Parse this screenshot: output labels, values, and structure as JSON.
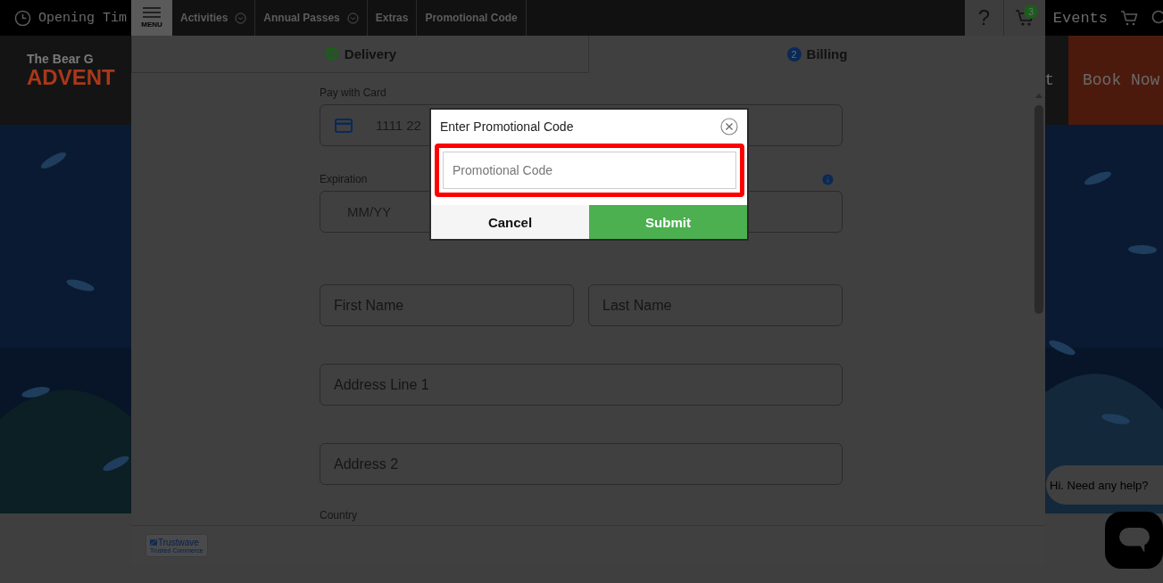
{
  "page_header": {
    "opening_times": "Opening Tim",
    "logo_line_1": "The Bear G",
    "logo_line_2": "ADVENT",
    "events": "Events",
    "nav_fragment": "t",
    "book_now": "Book Now"
  },
  "checkout": {
    "menu_label": "MENU",
    "nav": [
      {
        "label": "Activities",
        "dropdown": true
      },
      {
        "label": "Annual Passes",
        "dropdown": true
      },
      {
        "label": "Extras",
        "dropdown": false
      },
      {
        "label": "Promotional Code",
        "dropdown": false
      }
    ],
    "help": "?",
    "cart_count": "3",
    "steps": [
      {
        "label": "Delivery",
        "done": true,
        "selected": false
      },
      {
        "number": "2",
        "label": "Billing",
        "done": false,
        "selected": true
      }
    ],
    "rows": [
      {
        "label": "Pay with Card",
        "fields": [
          {
            "placeholder": "1111 22",
            "kind": "card"
          }
        ]
      },
      {
        "label": "Expiration",
        "info": true,
        "fields": [
          {
            "placeholder": "MM/YY",
            "kind": "short"
          }
        ]
      },
      {
        "fields": [
          {
            "placeholder": "First Name",
            "kind": "text"
          },
          {
            "placeholder": "Last Name",
            "kind": "text"
          }
        ]
      },
      {
        "fields": [
          {
            "placeholder": "Address Line 1",
            "kind": "text"
          }
        ]
      },
      {
        "fields": [
          {
            "placeholder": "Address 2",
            "kind": "text"
          }
        ]
      },
      {
        "label": "Country",
        "fields": []
      }
    ],
    "footer": {
      "badge_line_1": "Trustwave",
      "badge_line_2": "Trusted Commerce"
    }
  },
  "promo_dialog": {
    "title": "Enter Promotional Code",
    "placeholder": "Promotional Code",
    "highlighted": true,
    "buttons": [
      {
        "label": "Cancel",
        "kind": "secondary"
      },
      {
        "label": "Submit",
        "kind": "primary"
      }
    ]
  },
  "chat": {
    "greeting": "Hi. Need any help?"
  }
}
